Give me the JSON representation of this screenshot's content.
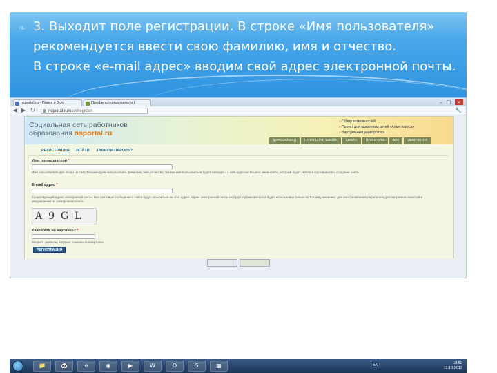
{
  "slide": {
    "bullet": "❧",
    "paragraph1": "3. Выходит поле регистрации. В строке «Имя пользователя» рекомендуется ввести свою фамилию, имя и отчество.",
    "paragraph2": "В строке «e-mail адрес» вводим свой адрес электронной почты."
  },
  "browser": {
    "tabs": [
      {
        "label": "nsportal.ru - Поиск в Goo",
        "favicon_color": "#4a76c0"
      },
      {
        "label": "Профиль пользователя |",
        "favicon_color": "#7a9a3a"
      }
    ],
    "address": {
      "host": "nsportal.ru",
      "path": "/user/register"
    }
  },
  "site": {
    "title_line1": "Социальная сеть работников",
    "title_line2_prefix": "образования ",
    "brand": "nsportal.ru",
    "header_links": [
      "Обзор возможностей",
      "Проект для одаренных детей «Алые паруса»",
      "Виртуальный университет"
    ],
    "categories": [
      "ДЕТСКИЙ САД",
      "НАЧАЛЬНАЯ ШКОЛА",
      "ШКОЛА",
      "НПО И СПО",
      "ВУЗ",
      "УВЛЕЧЕНИЯ"
    ]
  },
  "form": {
    "tabs": [
      "РЕГИСТРАЦИЯ",
      "ВОЙТИ",
      "ЗАБЫЛИ ПАРОЛЬ?"
    ],
    "username_label": "Имя пользователя",
    "username_hint": "Имя пользователя для входа на сайт. Рекомендуем использовать фамилию, имя, отчество, так как имя пользователя будет совпадать с web-адресом Вашего мини-сайта, который будет указан в сертификате о создании сайта.",
    "email_label": "E-mail адрес",
    "email_hint": "Существующий адрес электронной почты. Все почтовые сообщения с сайта будут отсылаться на этот адрес. Адрес электронной почты не будет публиковаться и будет использован только по Вашему желанию: для восстановления пароля или для получения новостей и уведомлений по электронной почте.",
    "captcha_text": "A9GL",
    "captcha_label": "Какой код на картинке?",
    "captcha_hint": "Введите символы, которые показаны на картинке.",
    "submit_label": "РЕГИСТРАЦИЯ",
    "required_mark": "*"
  },
  "taskbar": {
    "items": [
      "📁",
      "🐼",
      "e",
      "◉",
      "▶",
      "W",
      "O",
      "S",
      "▦"
    ],
    "language": "EN",
    "time": "18:52",
    "date": "11.10.2013"
  }
}
